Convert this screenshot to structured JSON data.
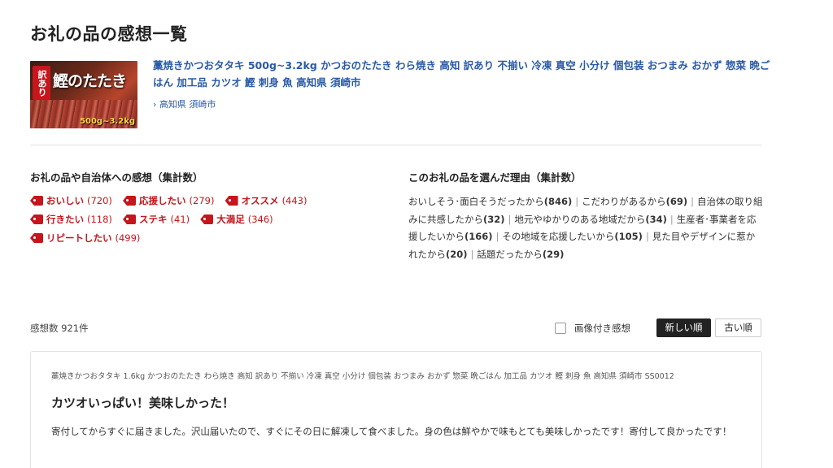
{
  "page": {
    "title": "お礼の品の感想一覧"
  },
  "product": {
    "thumbnail": {
      "badge": "訳あり",
      "calligraphy": "鰹のたたき",
      "weight": "500g~3.2kg"
    },
    "title": "藁焼きかつおタタキ 500g~3.2kg かつおのたたき わら焼き 高知 訳あり 不揃い 冷凍 真空 小分け 個包装 おつまみ おかず 惣菜 晩ごはん 加工品 カツオ 鰹 刺身 魚 高知県 須崎市",
    "location": "› 高知県 須崎市"
  },
  "impressions": {
    "heading": "お礼の品や自治体への感想（集計数）",
    "tags": [
      {
        "label": "おいしい",
        "count": "(720)"
      },
      {
        "label": "応援したい",
        "count": "(279)"
      },
      {
        "label": "オススメ",
        "count": "(443)"
      },
      {
        "label": "行きたい",
        "count": "(118)"
      },
      {
        "label": "ステキ",
        "count": "(41)"
      },
      {
        "label": "大満足",
        "count": "(346)"
      },
      {
        "label": "リピートしたい",
        "count": "(499)"
      }
    ]
  },
  "reasons": {
    "heading": "このお礼の品を選んだ理由（集計数）",
    "items": [
      {
        "label": "おいしそう･面白そうだったから",
        "count": "(846)"
      },
      {
        "label": "こだわりがあるから",
        "count": "(69)"
      },
      {
        "label": "自治体の取り組みに共感したから",
        "count": "(32)"
      },
      {
        "label": "地元やゆかりのある地域だから",
        "count": "(34)"
      },
      {
        "label": "生産者･事業者を応援したいから",
        "count": "(166)"
      },
      {
        "label": "その地域を応援したいから",
        "count": "(105)"
      },
      {
        "label": "見た目やデザインに惹かれたから",
        "count": "(20)"
      },
      {
        "label": "話題だったから",
        "count": "(29)"
      }
    ],
    "separator": "|"
  },
  "listing": {
    "count_label": "感想数 921件",
    "image_filter_label": "画像付き感想",
    "sort_new": "新しい順",
    "sort_old": "古い順"
  },
  "review": {
    "product": "藁焼きかつおタタキ 1.6kg かつおのたたき わら焼き 高知 訳あり 不揃い 冷凍 真空 小分け 個包装 おつまみ おかず 惣菜 晩ごはん 加工品 カツオ 鰹 刺身 魚 高知県 須崎市 SS0012",
    "title": "カツオいっぱい！美味しかった！",
    "body": "寄付してからすぐに届きました。沢山届いたので、すぐにその日に解凍して食べました。身の色は鮮やかで味もとても美味しかったです！寄付して良かったです！"
  },
  "colors": {
    "link": "#2a5aa6",
    "tag": "#c4161c",
    "sort_active_bg": "#222222"
  },
  "icons": {
    "tag": "tag-icon",
    "checkbox": "checkbox-icon"
  }
}
